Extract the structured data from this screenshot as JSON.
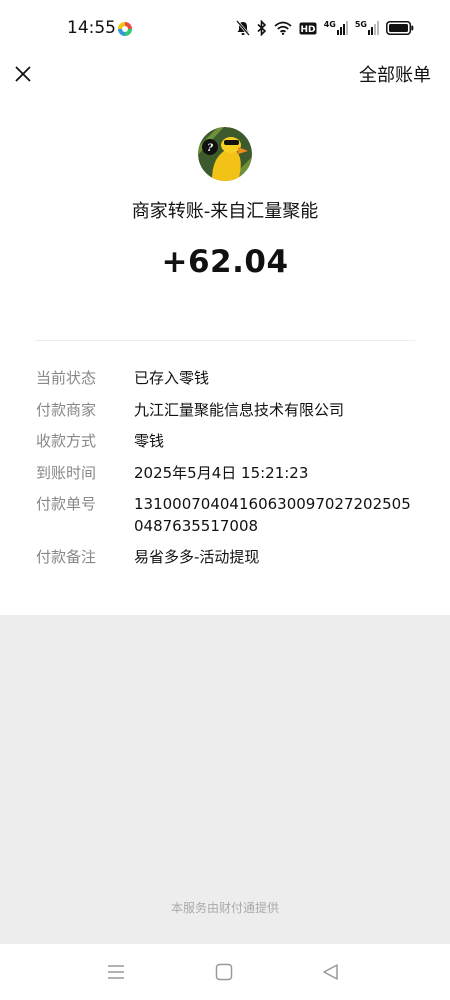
{
  "status_bar": {
    "time": "14:55",
    "network_4g": "4G",
    "network_5g": "5G",
    "hd_label": "HD"
  },
  "nav": {
    "right_link": "全部账单"
  },
  "transaction": {
    "title": "商家转账-来自汇量聚能",
    "amount": "+62.04",
    "details": [
      {
        "label": "当前状态",
        "value": "已存入零钱"
      },
      {
        "label": "付款商家",
        "value": "九江汇量聚能信息技术有限公司"
      },
      {
        "label": "收款方式",
        "value": "零钱"
      },
      {
        "label": "到账时间",
        "value": "2025年5月4日 15:21:23"
      },
      {
        "label": "付款单号",
        "value": "131000704041606300970272025050487635517008"
      },
      {
        "label": "付款备注",
        "value": "易省多多-活动提现"
      }
    ]
  },
  "footer": {
    "note": "本服务由财付通提供"
  },
  "colors": {
    "page_bg": "#ededed",
    "label_gray": "#888888"
  }
}
